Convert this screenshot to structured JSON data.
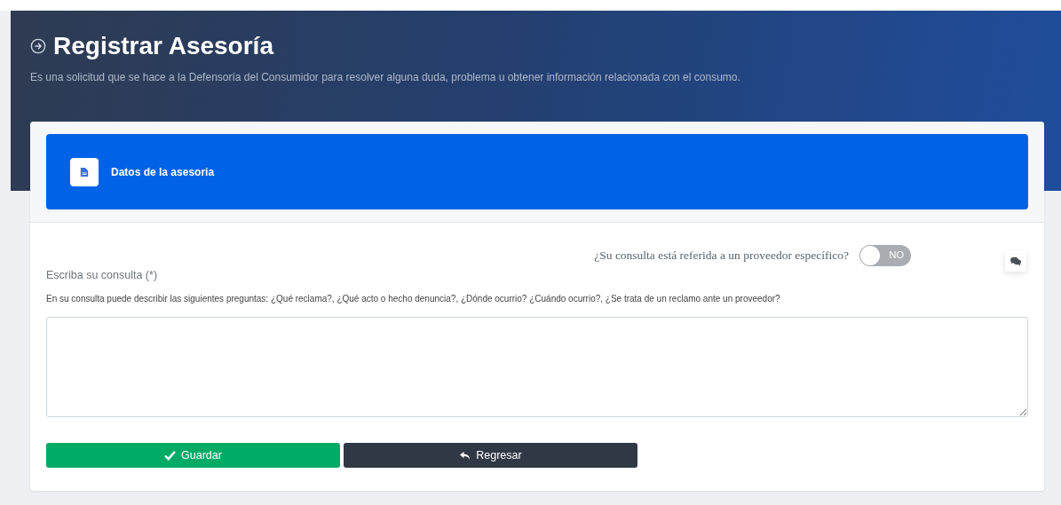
{
  "header": {
    "title": "Registrar Asesoría",
    "subtitle": "Es una solicitud que se hace a la Defensoría del Consumidor para resolver alguna duda, problema u obtener información relacionada con el consumo."
  },
  "section": {
    "title": "Datos de la asesoria"
  },
  "provider_question": {
    "label": "¿Su consulta está referida a un proveedor específico?",
    "toggle_text": "NO",
    "on": false
  },
  "consulta": {
    "label": "Escriba su consulta (*)",
    "hint": "En su consulta puede describir las siguientes preguntas: ¿Qué reclama?, ¿Qué acto o hecho denuncia?, ¿Dónde ocurrio? ¿Cuándo ocurrio?, ¿Se trata de un reclamo ante un proveedor?"
  },
  "buttons": [
    {
      "kind": "save",
      "label": "Guardar"
    },
    {
      "kind": "back",
      "label": "Regresar"
    }
  ]
}
